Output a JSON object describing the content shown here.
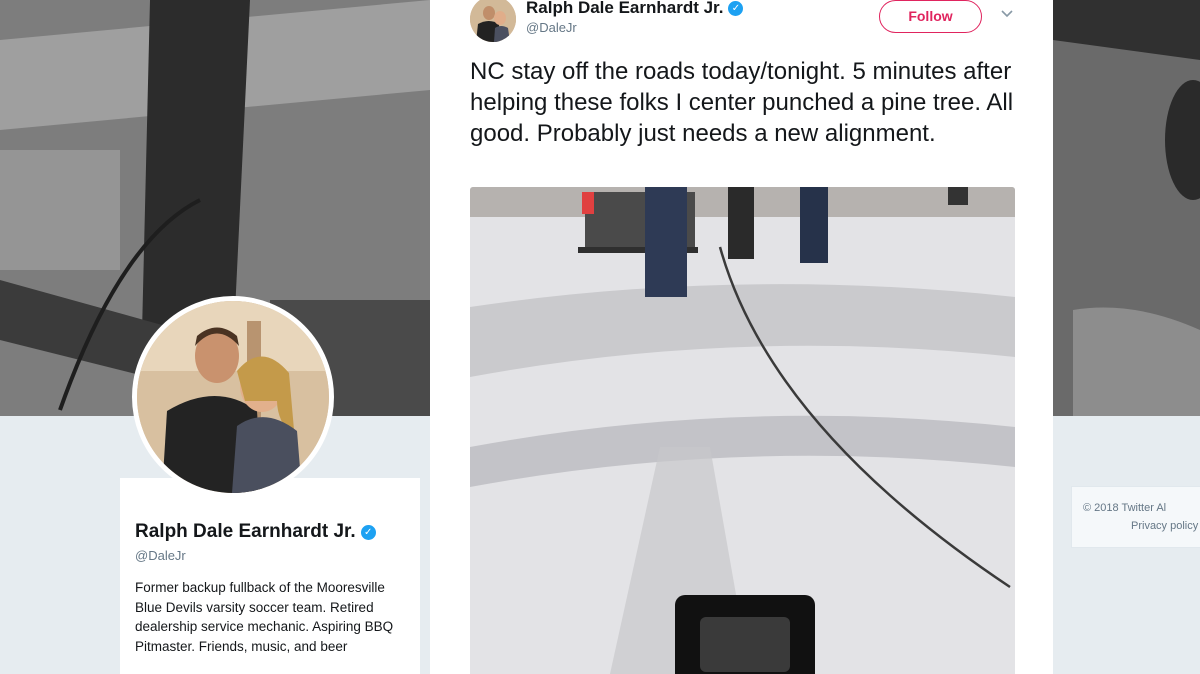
{
  "profile": {
    "name": "Ralph Dale Earnhardt Jr.",
    "handle": "@DaleJr",
    "bio": "Former backup fullback of the Mooresville Blue Devils varsity soccer team. Retired dealership service mechanic. Aspiring BBQ Pitmaster. Friends, music, and beer"
  },
  "footer": {
    "copyright": "© 2018 Twitter   Al",
    "privacy": "Privacy policy"
  },
  "tweet": {
    "author_name": "Ralph Dale Earnhardt Jr.",
    "author_handle": "@DaleJr",
    "follow_label": "Follow",
    "text": "NC stay off the roads today/tonight. 5 minutes after helping these folks I center punched a pine tree. All good. Probably just needs a new alignment."
  },
  "icons": {
    "verified": "verified-badge-icon",
    "caret": "chevron-down-icon"
  },
  "colors": {
    "follow_accent": "#e0245e",
    "verified_blue": "#1da1f2",
    "handle_gray": "#657786"
  }
}
